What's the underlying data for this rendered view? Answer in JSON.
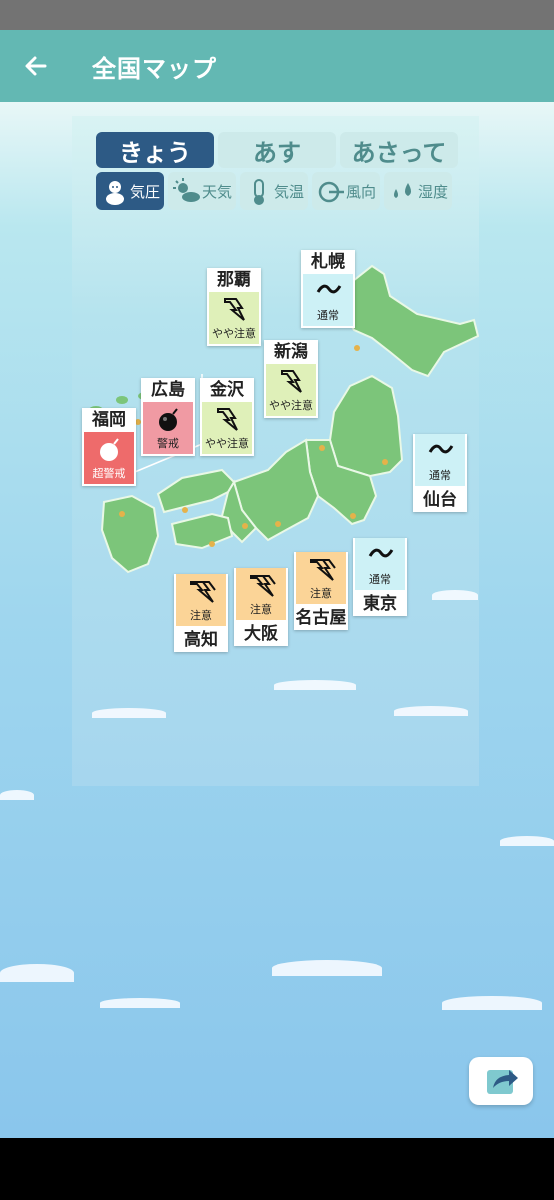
{
  "header": {
    "title": "全国マップ",
    "back_icon": "arrow-left-icon"
  },
  "day_tabs": [
    {
      "label": "きょう",
      "active": true
    },
    {
      "label": "あす",
      "active": false
    },
    {
      "label": "あさって",
      "active": false
    }
  ],
  "category_tabs": [
    {
      "label": "気圧",
      "icon": "mascot-icon",
      "active": true
    },
    {
      "label": "天気",
      "icon": "sun-cloud-icon",
      "active": false
    },
    {
      "label": "気温",
      "icon": "thermometer-icon",
      "active": false
    },
    {
      "label": "風向",
      "icon": "wind-icon",
      "active": false
    },
    {
      "label": "湿度",
      "icon": "droplets-icon",
      "active": false
    }
  ],
  "cities": [
    {
      "name": "札幌",
      "level": "通常"
    },
    {
      "name": "那覇",
      "level": "やや注意"
    },
    {
      "name": "新潟",
      "level": "やや注意"
    },
    {
      "name": "広島",
      "level": "警戒"
    },
    {
      "name": "金沢",
      "level": "やや注意"
    },
    {
      "name": "福岡",
      "level": "超警戒"
    },
    {
      "name": "仙台",
      "level": "通常"
    },
    {
      "name": "名古屋",
      "level": "注意"
    },
    {
      "name": "東京",
      "level": "通常"
    },
    {
      "name": "大阪",
      "level": "注意"
    },
    {
      "name": "高知",
      "level": "注意"
    }
  ],
  "colors": {
    "app_bar": "#63b8b3",
    "active_tab": "#2d5a85",
    "level_normal": "#cdf1f6",
    "level_slight": "#dff0b9",
    "level_caution": "#fbd497",
    "level_warn": "#f09aa3",
    "level_severe": "#ee6b6b",
    "land": "#7cc57a"
  },
  "share": {
    "icon": "share-icon"
  }
}
